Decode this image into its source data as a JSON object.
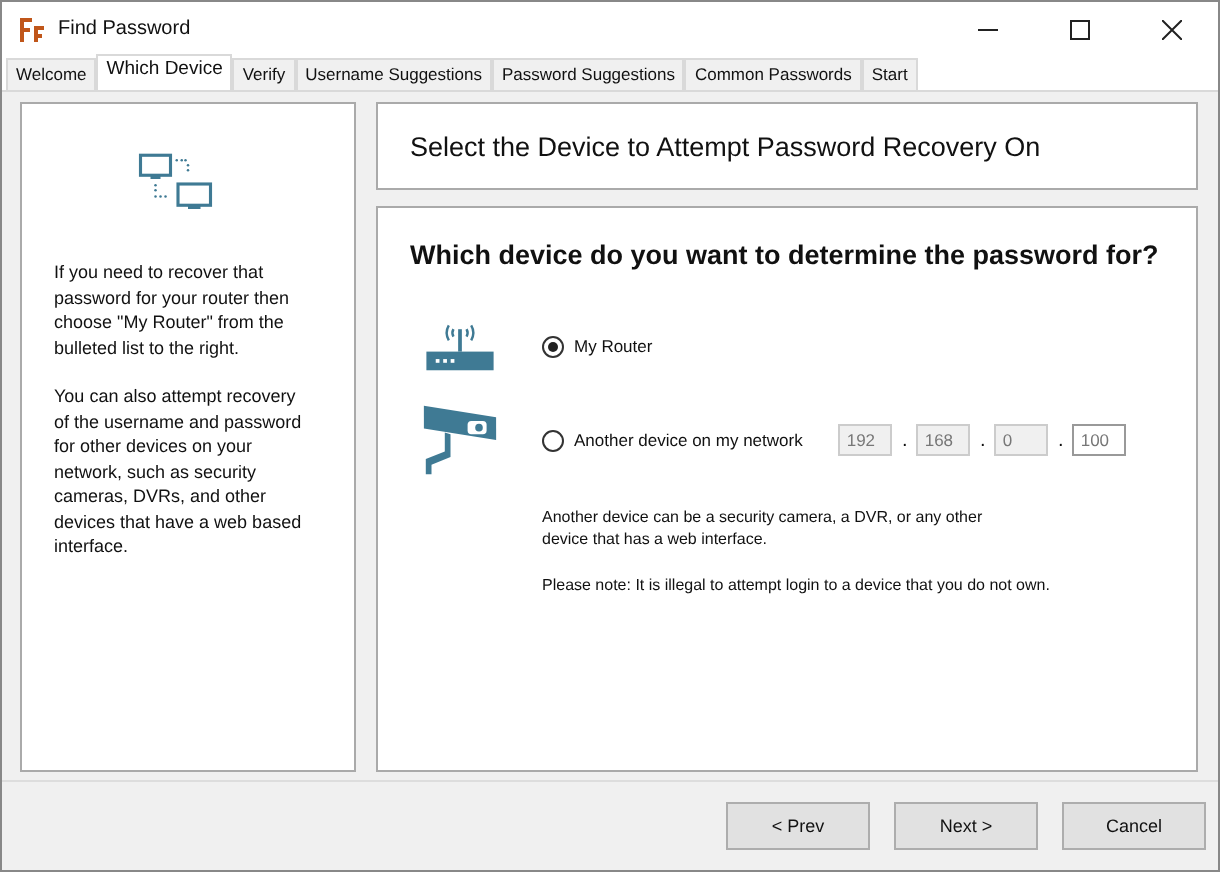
{
  "window": {
    "title": "Find Password"
  },
  "tabs": [
    {
      "label": "Welcome",
      "selected": false
    },
    {
      "label": "Which Device",
      "selected": true
    },
    {
      "label": "Verify",
      "selected": false
    },
    {
      "label": "Username Suggestions",
      "selected": false
    },
    {
      "label": "Password Suggestions",
      "selected": false
    },
    {
      "label": "Common Passwords",
      "selected": false
    },
    {
      "label": "Start",
      "selected": false
    }
  ],
  "sidebar": {
    "paragraphs": [
      "If you need to recover that password for your router then choose \"My Router\" from the bulleted list to the right.",
      "You can also attempt recovery of the username and password for other devices on your network, such as security cameras, DVRs, and other devices that have a web based interface."
    ]
  },
  "header": "Select the Device to Attempt Password Recovery On",
  "question": "Which device do you want to determine the password for?",
  "options": [
    {
      "kind": "router",
      "label": "My Router",
      "selected": true
    },
    {
      "kind": "camera",
      "label": "Another device on my network",
      "selected": false
    }
  ],
  "ip_fields": [
    {
      "value": "192",
      "disabled": true
    },
    {
      "value": "168",
      "disabled": true
    },
    {
      "value": "0",
      "disabled": true
    },
    {
      "value": "100",
      "disabled": false
    }
  ],
  "ip_separators": [
    ".",
    ".",
    "."
  ],
  "notes": [
    "Another device can be a security camera, a DVR, or any other device that has a web interface.",
    "Please note: It is illegal to attempt login to a device that you do not own."
  ],
  "buttons": [
    "< Prev",
    "Next >",
    "Cancel"
  ]
}
